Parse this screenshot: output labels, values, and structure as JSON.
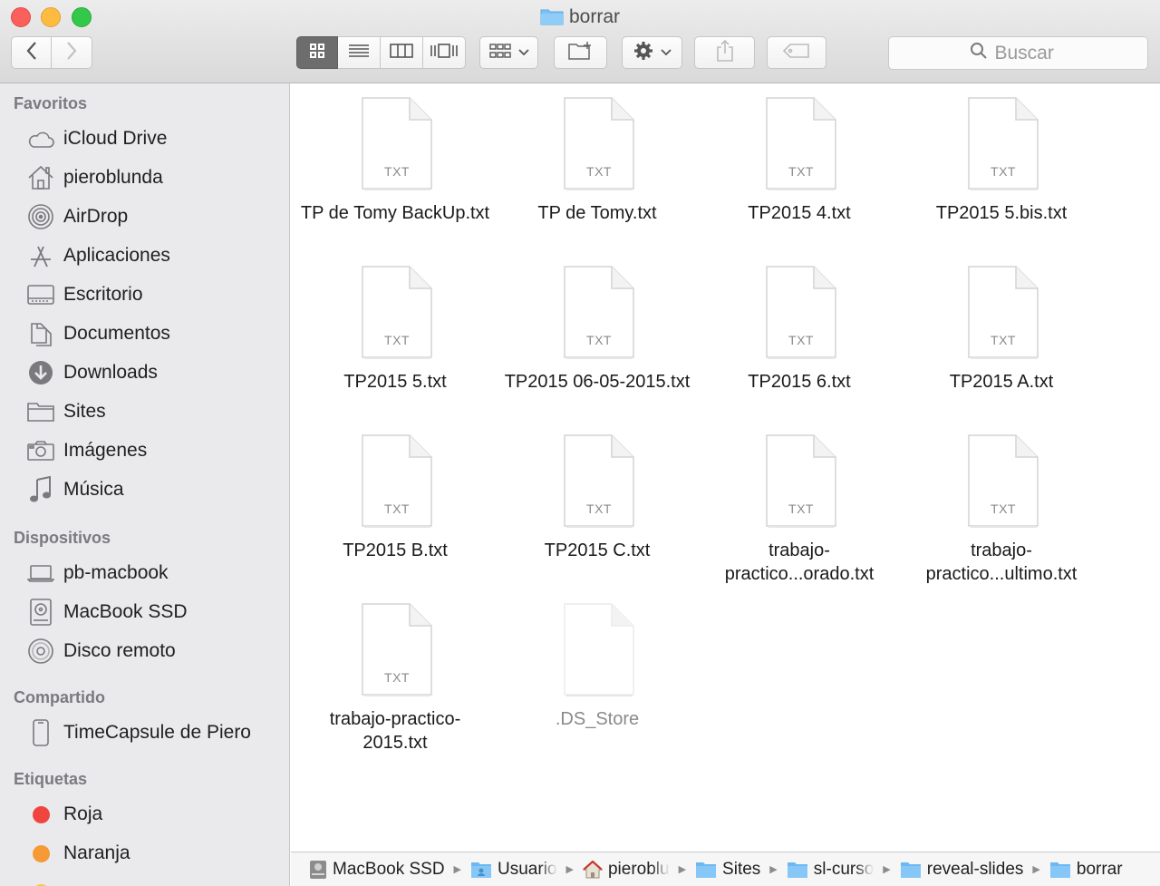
{
  "window": {
    "title": "borrar"
  },
  "toolbar": {
    "search_placeholder": "Buscar"
  },
  "sidebar": {
    "sections": [
      {
        "title": "Favoritos",
        "items": [
          {
            "label": "iCloud Drive",
            "icon": "cloud-icon"
          },
          {
            "label": "pieroblunda",
            "icon": "home-icon"
          },
          {
            "label": "AirDrop",
            "icon": "airdrop-icon"
          },
          {
            "label": "Aplicaciones",
            "icon": "applications-icon"
          },
          {
            "label": "Escritorio",
            "icon": "desktop-icon"
          },
          {
            "label": "Documentos",
            "icon": "documents-icon"
          },
          {
            "label": "Downloads",
            "icon": "download-icon"
          },
          {
            "label": "Sites",
            "icon": "folder-icon"
          },
          {
            "label": "Imágenes",
            "icon": "camera-icon"
          },
          {
            "label": "Música",
            "icon": "music-note-icon"
          }
        ]
      },
      {
        "title": "Dispositivos",
        "items": [
          {
            "label": "pb-macbook",
            "icon": "laptop-icon"
          },
          {
            "label": "MacBook SSD",
            "icon": "hard-drive-icon"
          },
          {
            "label": "Disco remoto",
            "icon": "optical-disc-icon"
          }
        ]
      },
      {
        "title": "Compartido",
        "items": [
          {
            "label": "TimeCapsule de Piero",
            "icon": "time-capsule-icon"
          }
        ]
      },
      {
        "title": "Etiquetas",
        "items": [
          {
            "label": "Roja",
            "icon": "tag-dot-icon",
            "color": "#f0453f"
          },
          {
            "label": "Naranja",
            "icon": "tag-dot-icon",
            "color": "#f59a35"
          }
        ]
      }
    ]
  },
  "files": [
    {
      "name": "TP de Tomy BackUp.txt",
      "type": "TXT",
      "hidden": false
    },
    {
      "name": "TP de Tomy.txt",
      "type": "TXT",
      "hidden": false
    },
    {
      "name": "TP2015 4.txt",
      "type": "TXT",
      "hidden": false
    },
    {
      "name": "TP2015 5.bis.txt",
      "type": "TXT",
      "hidden": false
    },
    {
      "name": "TP2015 5.txt",
      "type": "TXT",
      "hidden": false
    },
    {
      "name": "TP2015 06-05-2015.txt",
      "type": "TXT",
      "hidden": false
    },
    {
      "name": "TP2015 6.txt",
      "type": "TXT",
      "hidden": false
    },
    {
      "name": "TP2015 A.txt",
      "type": "TXT",
      "hidden": false
    },
    {
      "name": "TP2015 B.txt",
      "type": "TXT",
      "hidden": false
    },
    {
      "name": "TP2015 C.txt",
      "type": "TXT",
      "hidden": false
    },
    {
      "name": "trabajo-practico...orado.txt",
      "type": "TXT",
      "hidden": false
    },
    {
      "name": "trabajo-practico...ultimo.txt",
      "type": "TXT",
      "hidden": false
    },
    {
      "name": "trabajo-practico-2015.txt",
      "type": "TXT",
      "hidden": false
    },
    {
      "name": ".DS_Store",
      "type": "",
      "hidden": true
    }
  ],
  "pathbar": {
    "crumbs": [
      {
        "label": "MacBook SSD",
        "icon": "hard-drive-icon"
      },
      {
        "label": "Usuario",
        "icon": "users-folder-icon"
      },
      {
        "label": "pieroblu",
        "icon": "home-icon"
      },
      {
        "label": "Sites",
        "icon": "folder-icon"
      },
      {
        "label": "sl-curso",
        "icon": "folder-icon"
      },
      {
        "label": "reveal-slides",
        "icon": "folder-icon"
      },
      {
        "label": "borrar",
        "icon": "folder-icon"
      }
    ]
  }
}
